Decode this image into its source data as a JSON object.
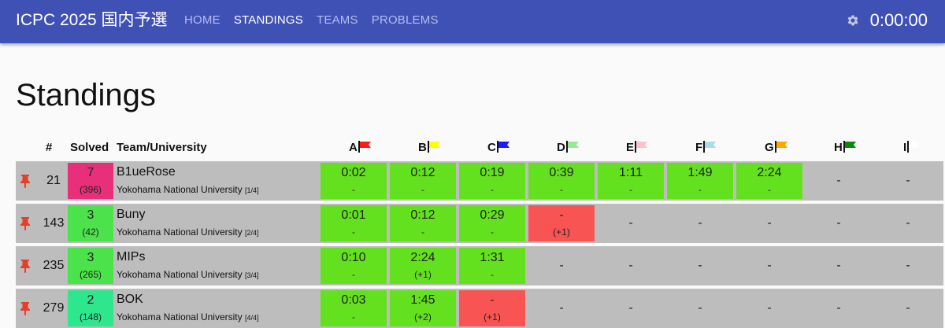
{
  "app": {
    "title": "ICPC 2025 国内予選",
    "clock": "0:00:00"
  },
  "nav": [
    {
      "label": "HOME",
      "active": false
    },
    {
      "label": "STANDINGS",
      "active": true
    },
    {
      "label": "TEAMS",
      "active": false
    },
    {
      "label": "PROBLEMS",
      "active": false
    }
  ],
  "page": {
    "title": "Standings"
  },
  "table": {
    "headers": {
      "rank": "#",
      "solved": "Solved",
      "team": "Team/University"
    },
    "problems": [
      {
        "letter": "A",
        "color": "#ff1a1a"
      },
      {
        "letter": "B",
        "color": "#ffff00"
      },
      {
        "letter": "C",
        "color": "#1a1aff"
      },
      {
        "letter": "D",
        "color": "#98e898"
      },
      {
        "letter": "E",
        "color": "#ffc0cb"
      },
      {
        "letter": "F",
        "color": "#a8dcea"
      },
      {
        "letter": "G",
        "color": "#ffa500"
      },
      {
        "letter": "H",
        "color": "#0a8a0a"
      },
      {
        "letter": "I",
        "color": "#ffffff"
      }
    ],
    "colors": {
      "accepted": "#64e11e",
      "rejected": "#f85454",
      "pin": "#e2402c"
    },
    "rows": [
      {
        "rank": "21",
        "solved": "7",
        "penalty": "(396)",
        "solved_color": "#e8307a",
        "team": "B1ueRose",
        "university": "Yokohama National University",
        "index": "[1/4]",
        "cells": [
          {
            "status": "ac",
            "time": "0:02",
            "tries": "-"
          },
          {
            "status": "ac",
            "time": "0:12",
            "tries": "-"
          },
          {
            "status": "ac",
            "time": "0:19",
            "tries": "-"
          },
          {
            "status": "ac",
            "time": "0:39",
            "tries": "-"
          },
          {
            "status": "ac",
            "time": "1:11",
            "tries": "-"
          },
          {
            "status": "ac",
            "time": "1:49",
            "tries": "-"
          },
          {
            "status": "ac",
            "time": "2:24",
            "tries": "-"
          },
          {
            "status": "none",
            "time": "-",
            "tries": ""
          },
          {
            "status": "none",
            "time": "-",
            "tries": ""
          }
        ]
      },
      {
        "rank": "143",
        "solved": "3",
        "penalty": "(42)",
        "solved_color": "#4ce24c",
        "team": "Buny",
        "university": "Yokohama National University",
        "index": "[2/4]",
        "cells": [
          {
            "status": "ac",
            "time": "0:01",
            "tries": "-"
          },
          {
            "status": "ac",
            "time": "0:12",
            "tries": "-"
          },
          {
            "status": "ac",
            "time": "0:29",
            "tries": "-"
          },
          {
            "status": "wa",
            "time": "-",
            "tries": "(+1)"
          },
          {
            "status": "none",
            "time": "-",
            "tries": ""
          },
          {
            "status": "none",
            "time": "-",
            "tries": ""
          },
          {
            "status": "none",
            "time": "-",
            "tries": ""
          },
          {
            "status": "none",
            "time": "-",
            "tries": ""
          },
          {
            "status": "none",
            "time": "-",
            "tries": ""
          }
        ]
      },
      {
        "rank": "235",
        "solved": "3",
        "penalty": "(265)",
        "solved_color": "#4ce24c",
        "team": "MIPs",
        "university": "Yokohama National University",
        "index": "[3/4]",
        "cells": [
          {
            "status": "ac",
            "time": "0:10",
            "tries": "-"
          },
          {
            "status": "ac",
            "time": "2:24",
            "tries": "(+1)"
          },
          {
            "status": "ac",
            "time": "1:31",
            "tries": "-"
          },
          {
            "status": "none",
            "time": "-",
            "tries": ""
          },
          {
            "status": "none",
            "time": "-",
            "tries": ""
          },
          {
            "status": "none",
            "time": "-",
            "tries": ""
          },
          {
            "status": "none",
            "time": "-",
            "tries": ""
          },
          {
            "status": "none",
            "time": "-",
            "tries": ""
          },
          {
            "status": "none",
            "time": "-",
            "tries": ""
          }
        ]
      },
      {
        "rank": "279",
        "solved": "2",
        "penalty": "(148)",
        "solved_color": "#2ee68c",
        "team": "BOK",
        "university": "Yokohama National University",
        "index": "[4/4]",
        "cells": [
          {
            "status": "ac",
            "time": "0:03",
            "tries": "-"
          },
          {
            "status": "ac",
            "time": "1:45",
            "tries": "(+2)"
          },
          {
            "status": "wa",
            "time": "-",
            "tries": "(+1)"
          },
          {
            "status": "none",
            "time": "-",
            "tries": ""
          },
          {
            "status": "none",
            "time": "-",
            "tries": ""
          },
          {
            "status": "none",
            "time": "-",
            "tries": ""
          },
          {
            "status": "none",
            "time": "-",
            "tries": ""
          },
          {
            "status": "none",
            "time": "-",
            "tries": ""
          },
          {
            "status": "none",
            "time": "-",
            "tries": ""
          }
        ]
      }
    ]
  }
}
